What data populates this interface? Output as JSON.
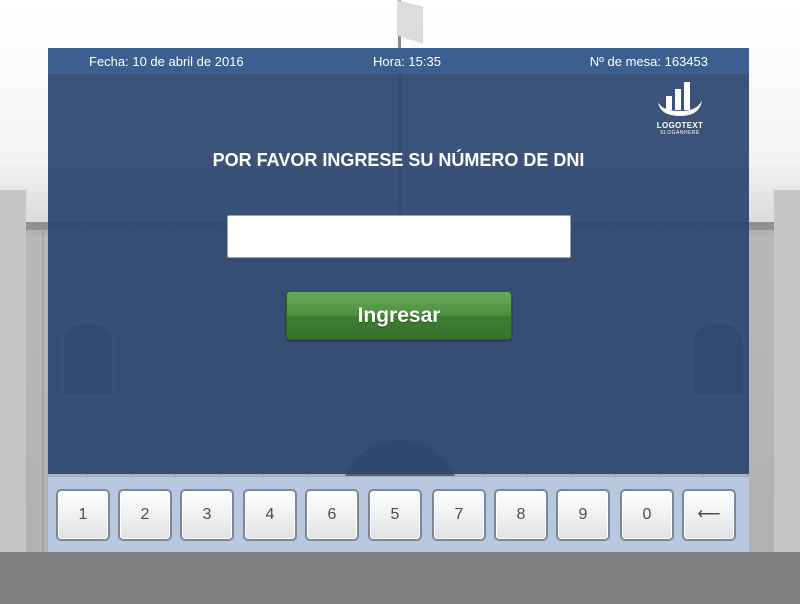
{
  "header": {
    "date": "Fecha: 10 de abril de 2016",
    "time": "Hora: 15:35",
    "table_number": "Nº de mesa: 163453"
  },
  "logo": {
    "name": "LOGOTEXT",
    "slogan": "SLOGANHERE",
    "icon": "bar-chart-logo-icon"
  },
  "prompt": "POR FAVOR INGRESE SU NÚMERO DE DNI",
  "dni_input": {
    "value": "",
    "placeholder": ""
  },
  "submit_label": "Ingresar",
  "keypad": {
    "keys": [
      "1",
      "2",
      "3",
      "4",
      "6",
      "5",
      "7",
      "8",
      "9",
      "0"
    ],
    "backspace_icon": "left-arrow-icon",
    "backspace_glyph": "⟵"
  },
  "colors": {
    "panel": "#2c466e",
    "header_bar": "#3b5f8e",
    "submit_button": "#4b8f3d",
    "keypad_bg": "#b8c8de"
  }
}
